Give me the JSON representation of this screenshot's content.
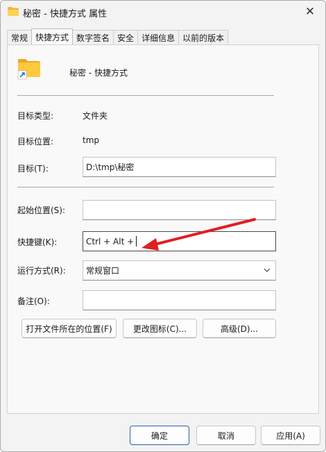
{
  "window": {
    "title": "秘密 - 快捷方式 属性",
    "close_glyph": "✕"
  },
  "tabs": [
    {
      "label": "常规",
      "active": false
    },
    {
      "label": "快捷方式",
      "active": true
    },
    {
      "label": "数字签名",
      "active": false
    },
    {
      "label": "安全",
      "active": false
    },
    {
      "label": "详细信息",
      "active": false
    },
    {
      "label": "以前的版本",
      "active": false
    }
  ],
  "header": {
    "name": "秘密 - 快捷方式",
    "icon": "folder-shortcut-icon"
  },
  "fields": {
    "target_type_label": "目标类型:",
    "target_type_value": "文件夹",
    "target_location_label": "目标位置:",
    "target_location_value": "tmp",
    "target_label": "目标(T):",
    "target_value": "D:\\tmp\\秘密",
    "start_in_label": "起始位置(S):",
    "start_in_value": "",
    "shortcut_key_label": "快捷键(K):",
    "shortcut_key_value": "Ctrl + Alt +",
    "run_label": "运行方式(R):",
    "run_value": "常规窗口",
    "comment_label": "备注(O):",
    "comment_value": ""
  },
  "action_buttons": {
    "open_location": "打开文件所在的位置(F)",
    "change_icon": "更改图标(C)...",
    "advanced": "高级(D)..."
  },
  "footer_buttons": {
    "ok": "确定",
    "cancel": "取消",
    "apply": "应用(A)"
  },
  "colors": {
    "accent": "#2a5fa8",
    "annotation_arrow": "#e02020",
    "folder": "#f5c542"
  }
}
